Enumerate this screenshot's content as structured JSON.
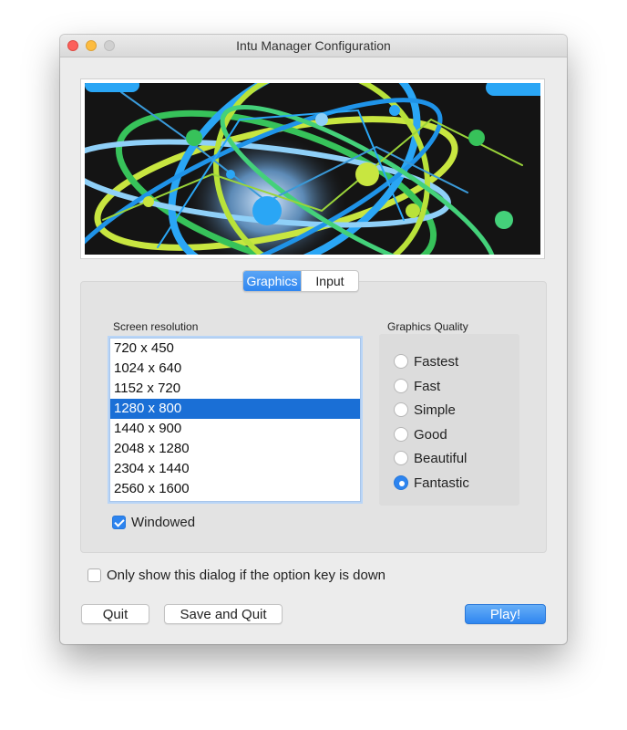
{
  "window": {
    "title": "Intu Manager Configuration"
  },
  "tabs": [
    {
      "label": "Graphics",
      "active": true
    },
    {
      "label": "Input",
      "active": false
    }
  ],
  "graphics": {
    "resolution_label": "Screen resolution",
    "resolutions": [
      "720 x 450",
      "1024 x 640",
      "1152 x 720",
      "1280 x 800",
      "1440 x 900",
      "2048 x 1280",
      "2304 x 1440",
      "2560 x 1600"
    ],
    "selected_resolution": "1280 x 800",
    "windowed_label": "Windowed",
    "windowed_checked": true,
    "quality_label": "Graphics Quality",
    "quality_options": [
      "Fastest",
      "Fast",
      "Simple",
      "Good",
      "Beautiful",
      "Fantastic"
    ],
    "selected_quality": "Fantastic"
  },
  "option_key": {
    "label": "Only show this dialog if the option key is down",
    "checked": false
  },
  "buttons": {
    "quit": "Quit",
    "save_and_quit": "Save and Quit",
    "play": "Play!"
  },
  "colors": {
    "accent": "#2f86f0",
    "selection": "#1a6fd6",
    "banner_blue": "#2aa6f5",
    "banner_lime": "#c8e640",
    "banner_green": "#37c25a"
  }
}
